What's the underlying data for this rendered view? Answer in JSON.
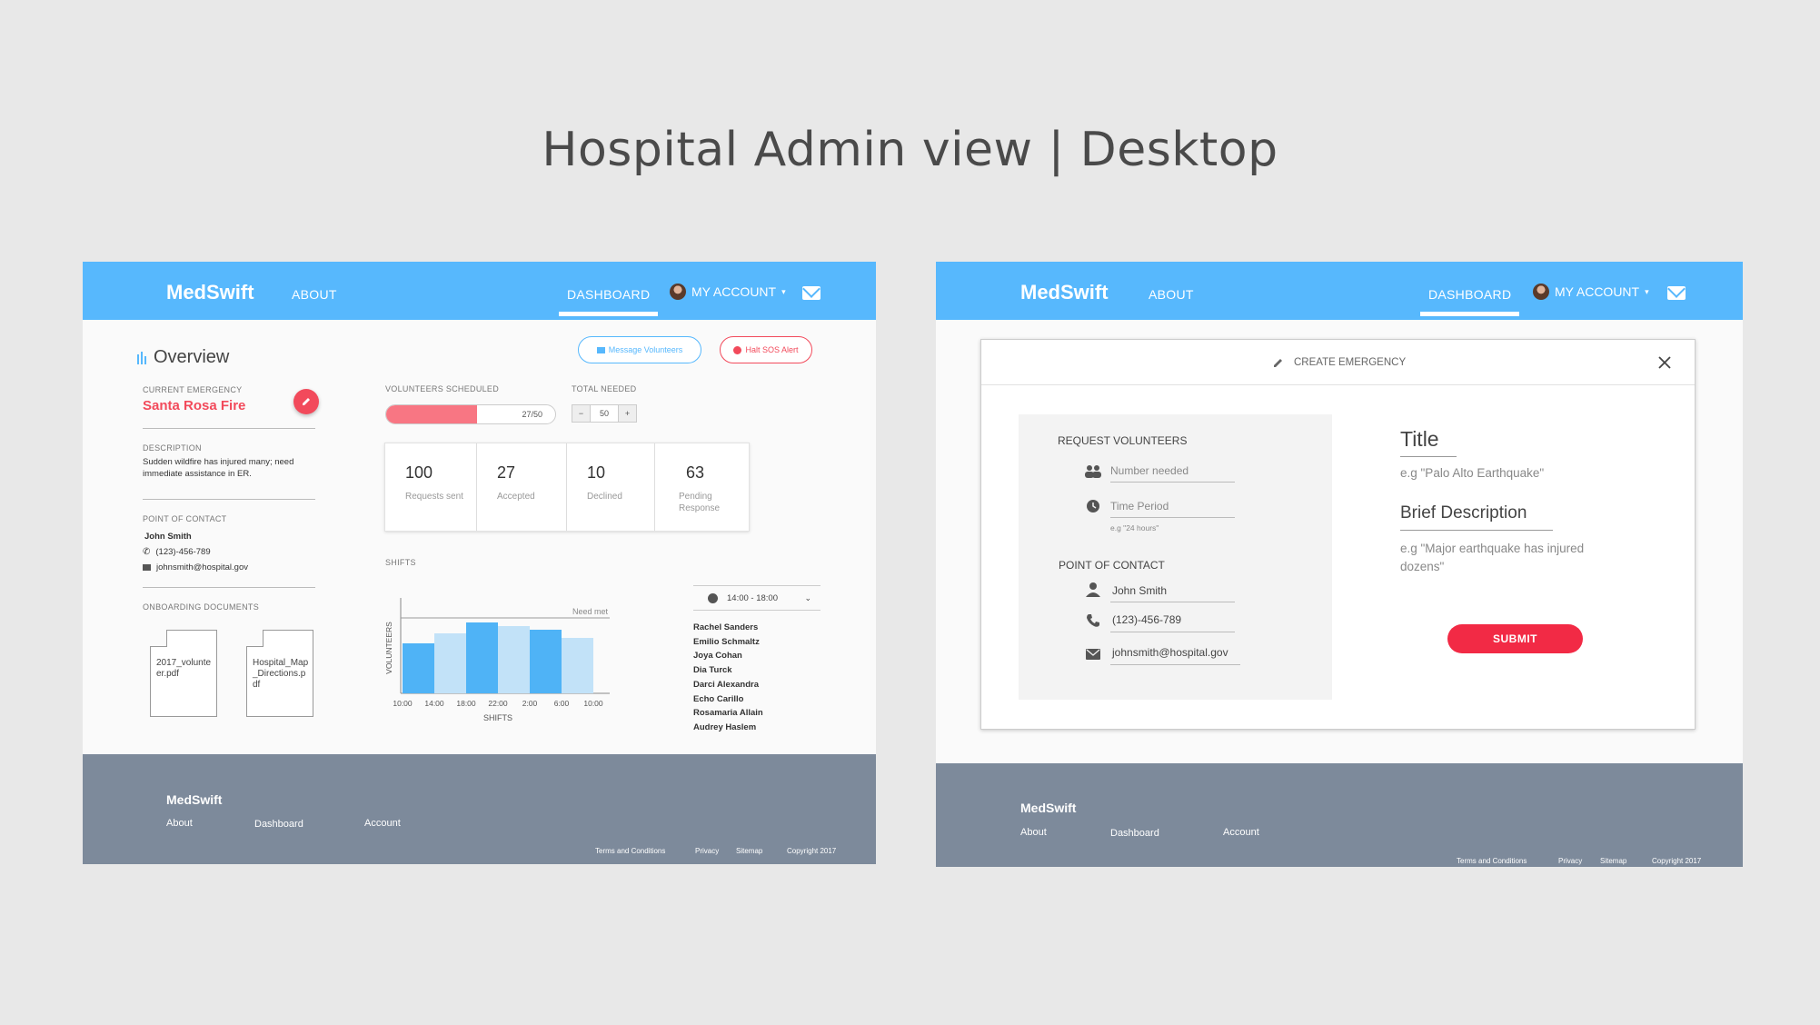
{
  "headline": "Hospital Admin view | Desktop",
  "colors": {
    "nav_blue": "#57b8fd",
    "accent_red": "#f24a5b",
    "footer_gray": "#7d8a9b",
    "bar_blue": "#4fb3f6",
    "bar_light": "#c2e2f8"
  },
  "left": {
    "nav": {
      "brand": "MedSwift",
      "about": "ABOUT",
      "dashboard": "DASHBOARD",
      "account": "MY ACCOUNT"
    },
    "overview_title": "Overview",
    "message_btn": "Message Volunteers",
    "sos_btn": "Halt SOS Alert",
    "current_emergency_label": "CURRENT EMERGENCY",
    "current_emergency": "Santa Rosa Fire",
    "description_label": "DESCRIPTION",
    "description": "Sudden wildfire has injured many; need immediate assistance in ER.",
    "poc_label": "POINT OF CONTACT",
    "poc_name": "John Smith",
    "poc_phone": "(123)-456-789",
    "poc_email": "johnsmith@hospital.gov",
    "docs_label": "ONBOARDING DOCUMENTS",
    "docs": [
      "2017_volunteer.pdf",
      "Hospital_Map_Directions.pdf"
    ],
    "volunteers_label": "VOLUNTEERS SCHEDULED",
    "volunteers_progress": 0.54,
    "volunteers_value": "27/50",
    "total_label": "TOTAL NEEDED",
    "stepper_minus": "−",
    "stepper_value": "50",
    "stepper_plus": "+",
    "stats": [
      {
        "num": "100",
        "label": "Requests sent"
      },
      {
        "num": "27",
        "label": "Accepted"
      },
      {
        "num": "10",
        "label": "Declined"
      },
      {
        "num": "63",
        "label": "Pending Response"
      }
    ],
    "shifts_label": "SHIFTS",
    "shift_select": "14:00 - 18:00",
    "volunteer_names": [
      "Rachel Sanders",
      "Emilio Schmaltz",
      "Joya Cohan",
      "Dia Turck",
      "Darci Alexandra",
      "Echo Carillo",
      "Rosamaria Allain",
      "Audrey Haslem"
    ],
    "footer": {
      "brand": "MedSwift",
      "about": "About",
      "dashboard": "Dashboard",
      "account": "Account",
      "terms": "Terms and Conditions",
      "privacy": "Privacy",
      "sitemap": "Sitemap",
      "copyright": "Copyright 2017"
    }
  },
  "chart_data": {
    "type": "bar",
    "categories": [
      "10:00",
      "14:00",
      "18:00",
      "22:00",
      "2:00",
      "6:00",
      "10:00"
    ],
    "values": [
      0.55,
      0.66,
      0.78,
      0.74,
      0.7,
      0.61
    ],
    "highlighted": [
      true,
      false,
      true,
      false,
      true,
      false
    ],
    "xlabel": "SHIFTS",
    "ylabel": "VOLUNTEERS",
    "target_label": "Need met",
    "target": 0.83,
    "ylim": [
      0,
      1
    ]
  },
  "right": {
    "nav": {
      "brand": "MedSwift",
      "about": "ABOUT",
      "dashboard": "DASHBOARD",
      "account": "MY ACCOUNT"
    },
    "modal_title": "CREATE EMERGENCY",
    "request_label": "REQUEST VOLUNTEERS",
    "number_placeholder": "Number needed",
    "time_placeholder": "Time Period",
    "time_hint": "e.g \"24 hours\"",
    "poc_label": "POINT OF CONTACT",
    "poc_name": "John Smith",
    "poc_phone": "(123)-456-789",
    "poc_email": "johnsmith@hospital.gov",
    "title_label": "Title",
    "title_placeholder": "e.g \"Palo Alto Earthquake\"",
    "desc_label": "Brief Description",
    "desc_placeholder": "e.g \"Major earthquake has injured dozens\"",
    "submit": "SUBMIT",
    "footer": {
      "brand": "MedSwift",
      "about": "About",
      "dashboard": "Dashboard",
      "account": "Account",
      "terms": "Terms and Conditions",
      "privacy": "Privacy",
      "sitemap": "Sitemap",
      "copyright": "Copyright 2017"
    }
  }
}
